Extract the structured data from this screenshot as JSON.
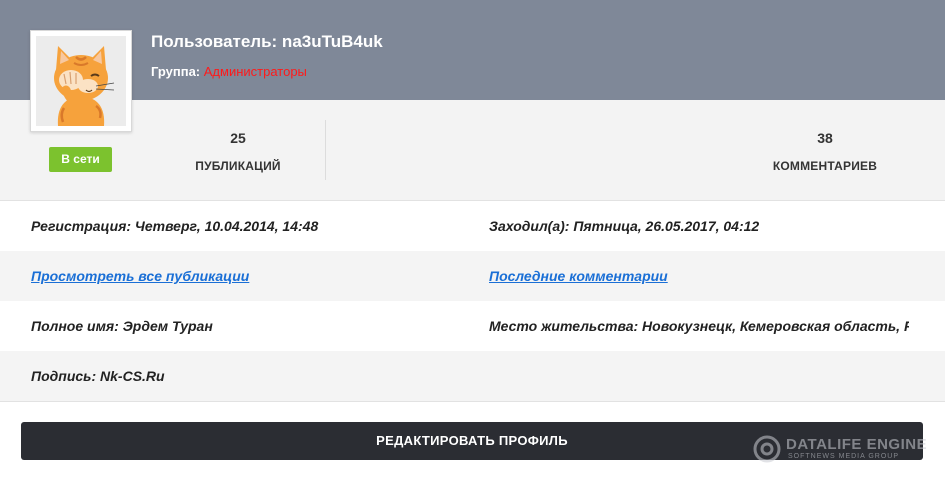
{
  "profile": {
    "username": "Пользователь: na3uTuB4uk",
    "group_label": "Группа:",
    "group_name": "Администраторы",
    "status_badge": "В сети",
    "avatar": "cat-facepalm-avatar"
  },
  "stats": {
    "publications": {
      "count": "25",
      "label": "ПУБЛИКАЦИЙ"
    },
    "comments": {
      "count": "38",
      "label": "КОММЕНТАРИЕВ"
    }
  },
  "details": {
    "registration": "Регистрация: Четверг, 10.04.2014, 14:48",
    "last_visit": "Заходил(а): Пятница, 26.05.2017, 04:12",
    "view_publications_link": "Просмотреть все публикации",
    "last_comments_link": "Последние комментарии",
    "full_name": "Полное имя: Эрдем Туран",
    "residence": "Место жительства: Новокузнецк, Кемеровская область, Р...",
    "signature": "Подпись: Nk-CS.Ru"
  },
  "actions": {
    "edit_profile": "РЕДАКТИРОВАТЬ ПРОФИЛЬ"
  },
  "watermark": {
    "title": "DATALIFE ENGINE",
    "subtitle": "SOFTNEWS MEDIA GROUP"
  },
  "colors": {
    "header_bg": "#7f8898",
    "group_name": "#ff1a1a",
    "online_badge": "#7cc22e",
    "link": "#1a6fd6",
    "button_bg": "#2b2d33"
  }
}
